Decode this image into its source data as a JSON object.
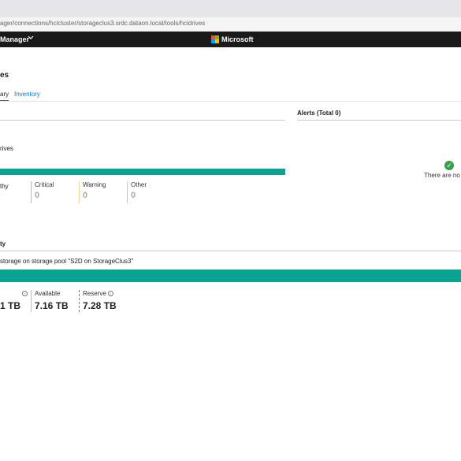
{
  "browser": {
    "url": "ager/connections/hcicluster/storageclus3.srdc.dataon.local/tools/hcidrives"
  },
  "app_header": {
    "title": "Manager",
    "brand": "Microsoft",
    "colors": {
      "header_bg": "#1a1a1a",
      "accent": "#0078d4"
    }
  },
  "page": {
    "title": "es",
    "tabs": [
      {
        "label": "ary",
        "active": true
      },
      {
        "label": "Inventory",
        "active": false
      }
    ]
  },
  "health": {
    "drives_text": "rives",
    "bar_color": "#0aa393",
    "categories": [
      {
        "label": "thy",
        "value": ""
      },
      {
        "label": "Critical",
        "value": "0",
        "color": "#e8a3a3"
      },
      {
        "label": "Warning",
        "value": "0",
        "color": "#f3d38a"
      },
      {
        "label": "Other",
        "value": "0",
        "color": "#c8c8c8"
      }
    ]
  },
  "alerts": {
    "title": "Alerts (Total 0)",
    "empty_text": "There are no a"
  },
  "capacity": {
    "title": "ty",
    "description": "storage on storage pool \"S2D on StorageClus3\"",
    "bar_color": "#0aa393",
    "metrics": [
      {
        "label": "",
        "value": "1 TB"
      },
      {
        "label": "Available",
        "value": "7.16 TB"
      },
      {
        "label": "Reserve",
        "value": "7.28 TB"
      }
    ]
  }
}
